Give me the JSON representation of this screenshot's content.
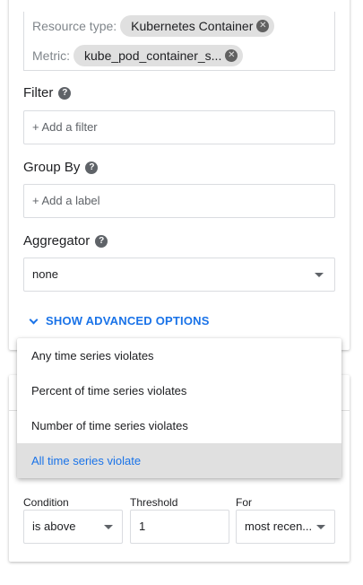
{
  "resource": {
    "resource_type_label": "Resource type:",
    "resource_type_value": "Kubernetes Container",
    "metric_label": "Metric:",
    "metric_value": "kube_pod_container_s..."
  },
  "filter": {
    "label": "Filter",
    "placeholder": "+ Add a filter"
  },
  "group_by": {
    "label": "Group By",
    "placeholder": "+ Add a label"
  },
  "aggregator": {
    "label": "Aggregator",
    "value": "none"
  },
  "advanced_options": {
    "label": "SHOW ADVANCED OPTIONS"
  },
  "menu": {
    "items": [
      "Any time series violates",
      "Percent of time series violates",
      "Number of time series violates",
      "All time series violate"
    ],
    "selected_index": 3
  },
  "condition": {
    "label": "Condition",
    "value": "is above"
  },
  "threshold": {
    "label": "Threshold",
    "value": "1"
  },
  "for": {
    "label": "For",
    "value": "most recen..."
  },
  "icons": {
    "chip_close": "close-circle-icon",
    "help": "help-circle-icon",
    "dropdown": "caret-down-icon",
    "expand": "chevron-down-icon"
  },
  "colors": {
    "accent": "#1a73e8",
    "chip": "#e0e0e0",
    "selected_bg": "#e0e0e0"
  }
}
